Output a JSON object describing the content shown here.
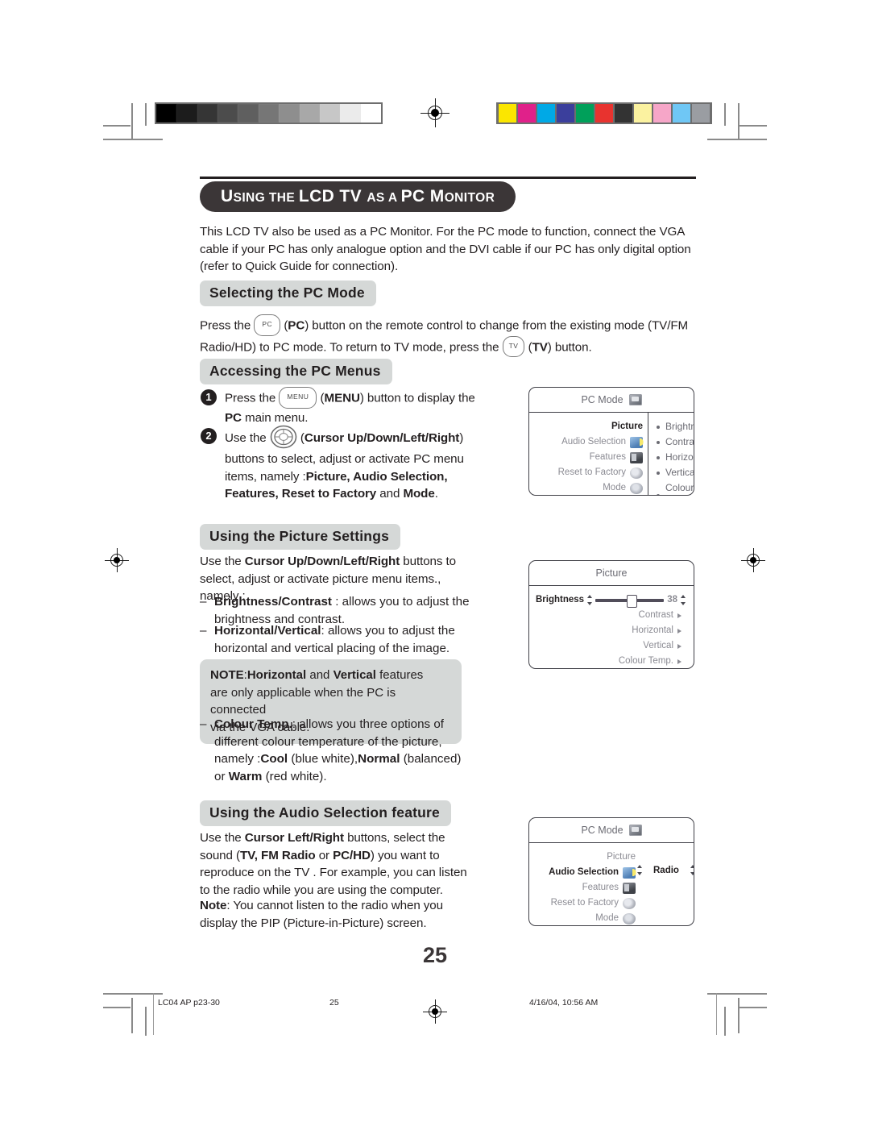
{
  "chapter": {
    "title_segments": [
      {
        "text": "U",
        "style": "cap"
      },
      {
        "text": "SING THE ",
        "style": "smallcap"
      },
      {
        "text": "LCD TV ",
        "style": "cap"
      },
      {
        "text": "AS A ",
        "style": "smallcap"
      },
      {
        "text": "PC M",
        "style": "cap"
      },
      {
        "text": "ONITOR",
        "style": "smallcap"
      }
    ],
    "title_plain": "USING THE LCD TV AS A PC MONITOR"
  },
  "intro": {
    "line1": "This LCD TV also be used as a PC Monitor. For the PC mode to function, connect the VGA",
    "line2": "cable if your PC has only analogue option and the DVI cable if our PC has only digital option",
    "line3": "(refer to Quick Guide for connection)."
  },
  "sections": {
    "selecting_pc_mode": {
      "heading": "Selecting the PC Mode",
      "text_a": "Press the",
      "key_pc": "PC",
      "text_b": "(",
      "bold_pc": "PC",
      "text_c": ") button on the remote control to change from the existing mode (TV/FM",
      "text_d": "Radio/HD) to PC mode. To return to TV mode, press the",
      "key_tv": "TV",
      "text_e": "(",
      "bold_tv": "TV",
      "text_f": ") button."
    },
    "accessing_pc_menus": {
      "heading": "Accessing the PC Menus",
      "step1": {
        "number": "1",
        "text_a": "Press the",
        "key_menu": "MENU",
        "text_b": "(",
        "bold_menu": "MENU",
        "text_c": ") button to display the",
        "bold_pc": "PC",
        "text_d": "main menu."
      },
      "step2": {
        "number": "2",
        "text_a": "Use the",
        "cursor_icon": "cursor-pad-icon",
        "text_b": "(",
        "bold_cursor": "Cursor Up/Down/Left/Right",
        "text_c": ")",
        "text_d": "buttons to select, adjust or activate PC menu",
        "text_e": "items, namely :",
        "bold_items_1": "Picture, Audio Selection,",
        "bold_items_2": "Features, Reset to Factory",
        "text_f": "and",
        "bold_items_3": "Mode",
        "text_g": "."
      }
    },
    "picture_settings": {
      "heading": "Using the Picture Settings",
      "intro_a": "Use the",
      "intro_bold": "Cursor Up/Down/Left/Right",
      "intro_b": "buttons to",
      "intro_c": "select, adjust or activate picture menu items., namely :",
      "items": [
        {
          "bold": "Brightness/Contrast",
          "text_a": ": allows you to adjust the",
          "text_b": "brightness and contrast."
        },
        {
          "bold": "Horizontal/Vertical",
          "text_a": ": allows you to adjust the",
          "text_b": "horizontal and vertical placing of the image."
        }
      ],
      "note": {
        "label": "NOTE",
        "sep": ":",
        "bold_1": "Horizontal",
        "mid": "and",
        "bold_2": "Vertical",
        "tail": "features",
        "line2": "are only applicable when the PC is connected",
        "line3": "via the VGA cable."
      },
      "colour_temp": {
        "bold": "Colour Temp.",
        "text_a": ": allows you three options of",
        "text_b": "different colour temperature of the picture,",
        "text_c": "namely :",
        "opt_cool": "Cool",
        "opt_cool_desc": "(blue white),",
        "opt_normal": "Normal",
        "opt_normal_desc": "(balanced)",
        "text_d": "or",
        "opt_warm": "Warm",
        "opt_warm_desc": "(red white)."
      }
    },
    "audio_selection": {
      "heading": "Using the Audio Selection feature",
      "p_a": "Use the",
      "p_bold_1": "Cursor Left/Right",
      "p_b": "buttons, select the",
      "p_c": "sound (",
      "p_bold_2": "TV, FM Radio",
      "p_d": "or",
      "p_bold_3": "PC/HD",
      "p_e": ") you want to",
      "p_f": "reproduce on the TV . For example, you can listen",
      "p_g": "to the radio while you are using the computer.",
      "note_label": "Note",
      "note_a": ": You cannot listen to the radio when you",
      "note_b": "display the PIP (Picture-in-Picture) screen."
    }
  },
  "osd_main_menu": {
    "title": "PC Mode",
    "title_icon": "monitor-icon",
    "left_items": [
      {
        "label": "Picture",
        "icon": null,
        "selected": true
      },
      {
        "label": "Audio Selection",
        "icon": "speaker-icon",
        "selected": false
      },
      {
        "label": "Features",
        "icon": "features-icon",
        "selected": false
      },
      {
        "label": "Reset to Factory",
        "icon": "reset-icon",
        "selected": false
      },
      {
        "label": "Mode",
        "icon": "mode-icon",
        "selected": false
      }
    ],
    "right_items": [
      "Brightness",
      "Contrast",
      "Horizontal",
      "Vertical",
      "Colour Temp."
    ]
  },
  "osd_picture_menu": {
    "title": "Picture",
    "rows": [
      {
        "label": "Brightness",
        "selected": true,
        "type": "slider",
        "value": "38",
        "knob_percent": 46
      },
      {
        "label": "Contrast",
        "selected": false,
        "type": "arrow"
      },
      {
        "label": "Horizontal",
        "selected": false,
        "type": "arrow"
      },
      {
        "label": "Vertical",
        "selected": false,
        "type": "arrow"
      },
      {
        "label": "Colour Temp.",
        "selected": false,
        "type": "arrow"
      }
    ]
  },
  "osd_audio_menu": {
    "title": "PC Mode",
    "title_icon": "monitor-icon",
    "left_items": [
      {
        "label": "Picture",
        "icon": null,
        "selected": false
      },
      {
        "label": "Audio Selection",
        "icon": "speaker-icon",
        "selected": true
      },
      {
        "label": "Features",
        "icon": "features-icon",
        "selected": false
      },
      {
        "label": "Reset to Factory",
        "icon": "reset-icon",
        "selected": false
      },
      {
        "label": "Mode",
        "icon": "mode-icon",
        "selected": false
      }
    ],
    "value_label": "Radio"
  },
  "footer": {
    "page_number": "25",
    "file_slug": "LC04 AP p23-30",
    "page_mark": "25",
    "timestamp": "4/16/04, 10:56 AM"
  },
  "calibration": {
    "greyscale": [
      "#000000",
      "#1c1c1c",
      "#353535",
      "#4c4c4c",
      "#5f5f5f",
      "#767676",
      "#8e8e8e",
      "#a8a8a8",
      "#c7c7c7",
      "#ebebeb",
      "#ffffff"
    ],
    "colours": [
      "#fbe600",
      "#e0218a",
      "#00a9e6",
      "#3b3f9c",
      "#00a05a",
      "#e8332f",
      "#333333",
      "#fbf2a0",
      "#f6a6c8",
      "#6fc7f5",
      "#9a9da2"
    ],
    "strip_background": "#6e6e6e"
  },
  "theme": {
    "banner_bg": "#3b3637",
    "heading_pill_bg": "#d5d8d7",
    "text": "#231f20",
    "osd_border": "#3f3f46",
    "osd_muted": "#8b8b93"
  }
}
